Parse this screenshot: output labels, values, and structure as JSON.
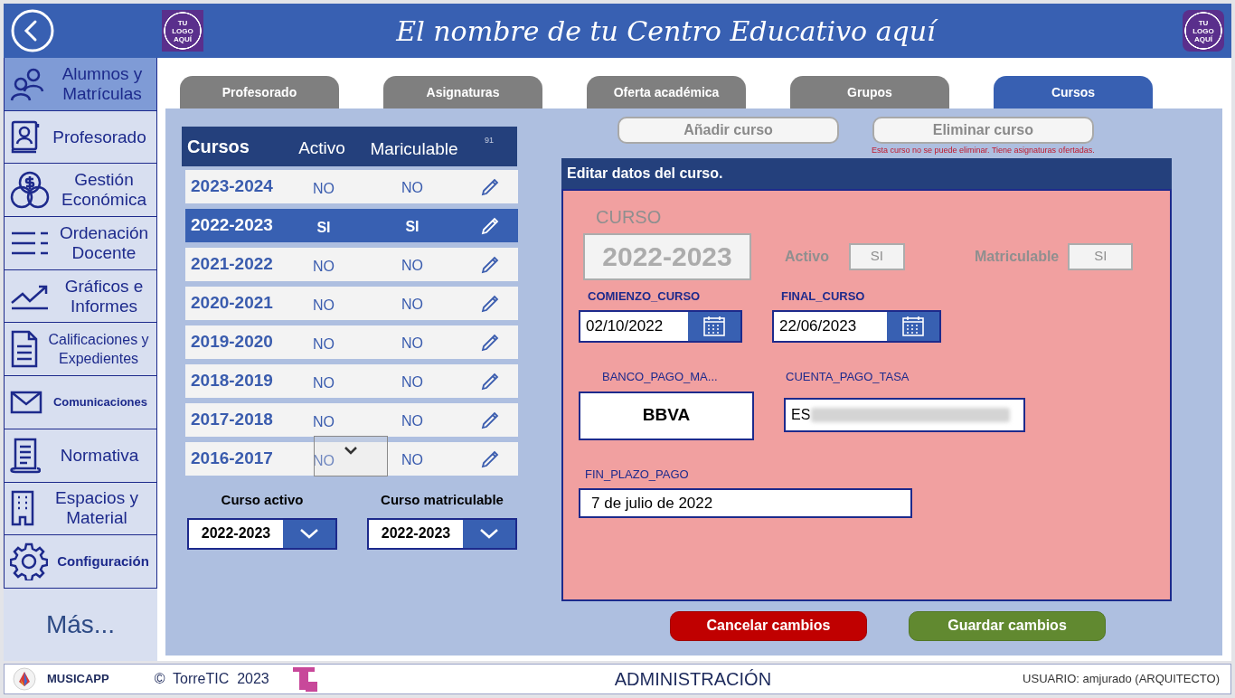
{
  "header": {
    "title": "El nombre de tu Centro Educativo aquí",
    "logo_left": "TU LOGO AQUÍ",
    "logo_right": "TU LOGO AQUÍ"
  },
  "sidebar": {
    "items": [
      {
        "label": "Alumnos y Matrículas",
        "selected": true
      },
      {
        "label": "Profesorado",
        "selected": false
      },
      {
        "label": "Gestión Económica",
        "selected": false
      },
      {
        "label": "Ordenación Docente",
        "selected": false
      },
      {
        "label": "Gráficos e Informes",
        "selected": false
      },
      {
        "label": "Calificaciones y Expedientes",
        "selected": false
      },
      {
        "label": "Comunicaciones",
        "selected": false
      },
      {
        "label": "Normativa",
        "selected": false
      },
      {
        "label": "Espacios y Material",
        "selected": false
      },
      {
        "label": "Configuración",
        "selected": false
      }
    ],
    "more": "Más..."
  },
  "tabs": [
    {
      "label": "Profesorado",
      "selected": false
    },
    {
      "label": "Asignaturas",
      "selected": false
    },
    {
      "label": "Oferta académica",
      "selected": false
    },
    {
      "label": "Grupos",
      "selected": false
    },
    {
      "label": "Cursos",
      "selected": true
    }
  ],
  "courses_table": {
    "columns": [
      "Cursos",
      "Activo",
      "Mariculable"
    ],
    "count": "91",
    "rows": [
      {
        "course": "2023-2024",
        "active": "NO",
        "enrollable": "NO",
        "selected": false
      },
      {
        "course": "2022-2023",
        "active": "SI",
        "enrollable": "SI",
        "selected": true
      },
      {
        "course": "2021-2022",
        "active": "NO",
        "enrollable": "NO",
        "selected": false
      },
      {
        "course": "2020-2021",
        "active": "NO",
        "enrollable": "NO",
        "selected": false
      },
      {
        "course": "2019-2020",
        "active": "NO",
        "enrollable": "NO",
        "selected": false
      },
      {
        "course": "2018-2019",
        "active": "NO",
        "enrollable": "NO",
        "selected": false
      },
      {
        "course": "2017-2018",
        "active": "NO",
        "enrollable": "NO",
        "selected": false
      },
      {
        "course": "2016-2017",
        "active": "NO",
        "enrollable": "NO",
        "selected": false
      }
    ]
  },
  "course_selectors": [
    {
      "label": "Curso activo",
      "value": "2022-2023"
    },
    {
      "label": "Curso matriculable",
      "value": "2022-2023"
    }
  ],
  "actions": [
    {
      "label": "Añadir curso",
      "disabled": true
    },
    {
      "label": "Eliminar curso",
      "disabled": true
    }
  ],
  "delete_error": "Esta curso no se puede eliminar. Tiene asignaturas ofertadas.",
  "edit_form": {
    "title": "Editar datos del curso.",
    "course_label": "CURSO",
    "course": "2022-2023",
    "active_label": "Activo",
    "active": "SI",
    "enrollable_label": "Matriculable",
    "enrollable": "SI",
    "flags_disabled": true,
    "start_label": "COMIENZO_CURSO",
    "start": "02/10/2022",
    "end_label": "FINAL_CURSO",
    "end": "22/06/2023",
    "bank_label": "BANCO_PAGO_MA...",
    "bank": "BBVA",
    "account_label": "CUENTA_PAGO_TASA",
    "account": "ES",
    "deadline_label": "FIN_PLAZO_PAGO",
    "deadline": "7 de julio de 2022"
  },
  "buttons": [
    {
      "label": "Cancelar cambios",
      "kind": "cancel"
    },
    {
      "label": "Guardar cambios",
      "kind": "save"
    }
  ],
  "footer": {
    "app": "MUSICAPP",
    "copyright": "©  TorreTIC  2023",
    "section": "ADMINISTRACIÓN",
    "user": "USUARIO: amjurado (ARQUITECTO)"
  }
}
